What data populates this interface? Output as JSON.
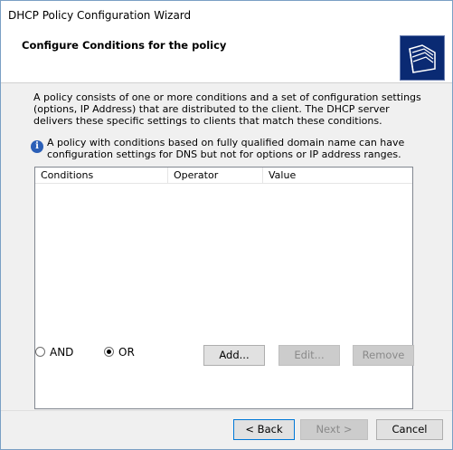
{
  "window": {
    "title": "DHCP Policy Configuration Wizard"
  },
  "header": {
    "title": "Configure Conditions for the policy",
    "icon": "folder-icon"
  },
  "description": "A policy consists of one or more conditions and a set of configuration settings (options, IP Address) that are distributed to the client. The DHCP server delivers these specific settings to clients that match these conditions.",
  "info": {
    "icon": "info-icon",
    "text": "A policy with conditions based on fully qualified domain name can have configuration settings for DNS but not for options or IP address ranges."
  },
  "conditions_table": {
    "columns": [
      "Conditions",
      "Operator",
      "Value"
    ],
    "rows": []
  },
  "logic": {
    "options": [
      {
        "label": "AND",
        "checked": false
      },
      {
        "label": "OR",
        "checked": true
      }
    ]
  },
  "actions": {
    "add": "Add...",
    "edit": "Edit...",
    "remove": "Remove"
  },
  "footer": {
    "back": "< Back",
    "next": "Next >",
    "cancel": "Cancel"
  }
}
